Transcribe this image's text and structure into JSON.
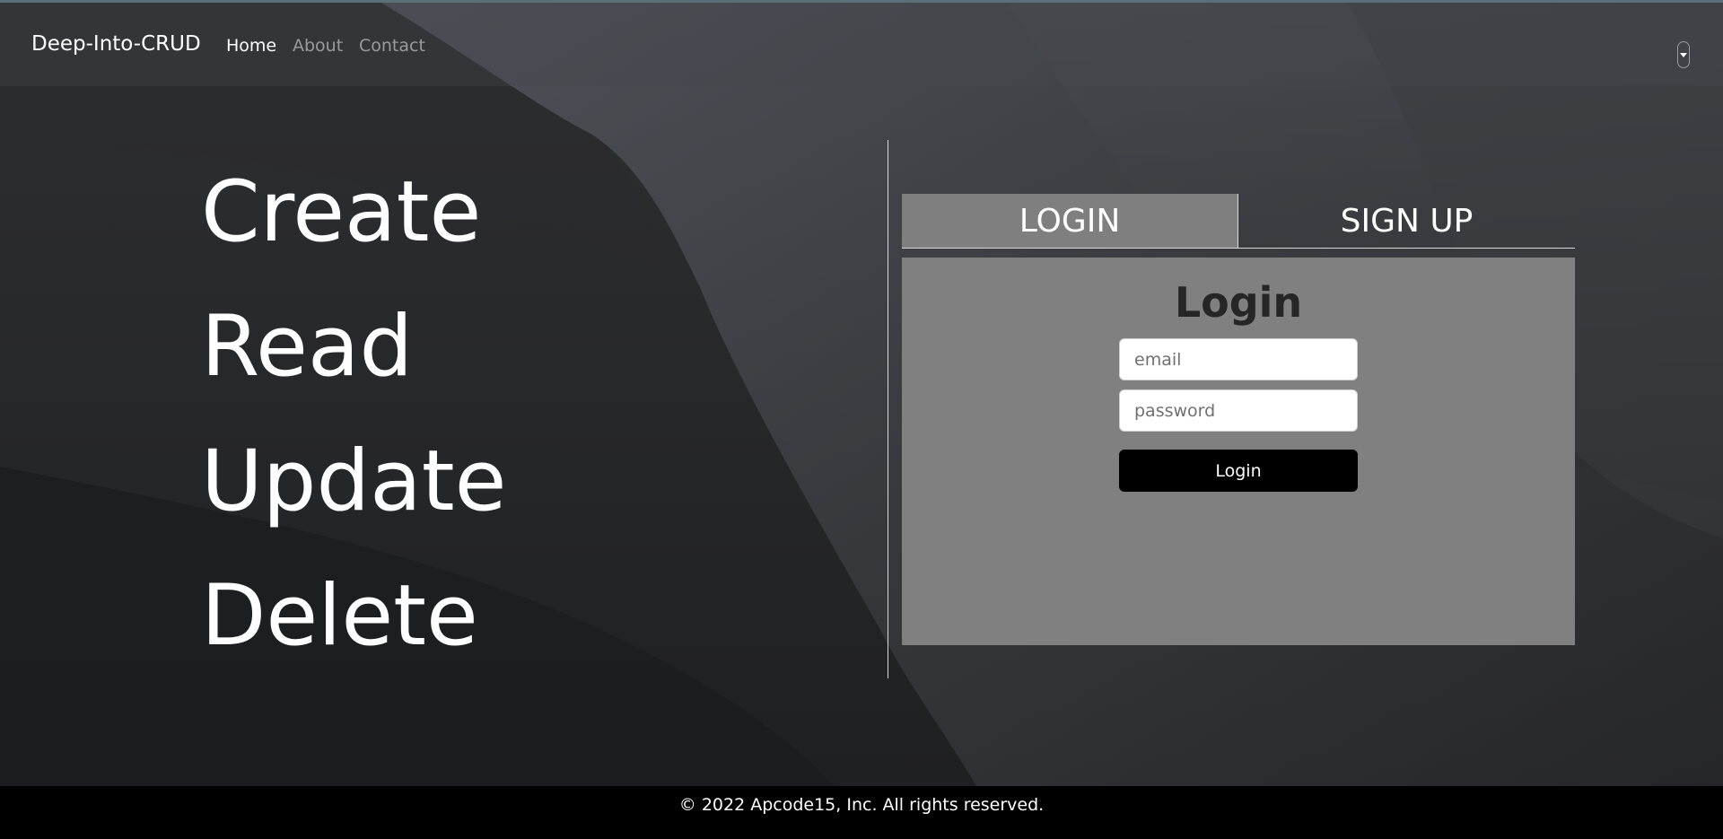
{
  "colors": {
    "background": "#232425",
    "navbar": "#3c3e43",
    "panel": "#808080",
    "footer": "#000000",
    "button": "#000000",
    "text": "#ffffff",
    "panel_title": "#262626"
  },
  "navbar": {
    "brand": "Deep-Into-CRUD",
    "links": [
      {
        "label": "Home",
        "active": true
      },
      {
        "label": "About",
        "active": false
      },
      {
        "label": "Contact",
        "active": false
      }
    ],
    "toggle_icon": "chevron-down-icon"
  },
  "hero": {
    "words": [
      "Create",
      "Read",
      "Update",
      "Delete"
    ]
  },
  "auth": {
    "tabs": [
      {
        "label": "LOGIN",
        "active": true
      },
      {
        "label": "SIGN UP",
        "active": false
      }
    ],
    "title": "Login",
    "email_placeholder": "email",
    "password_placeholder": "password",
    "submit_label": "Login"
  },
  "footer": {
    "text": "© 2022 Apcode15, Inc. All rights reserved."
  }
}
